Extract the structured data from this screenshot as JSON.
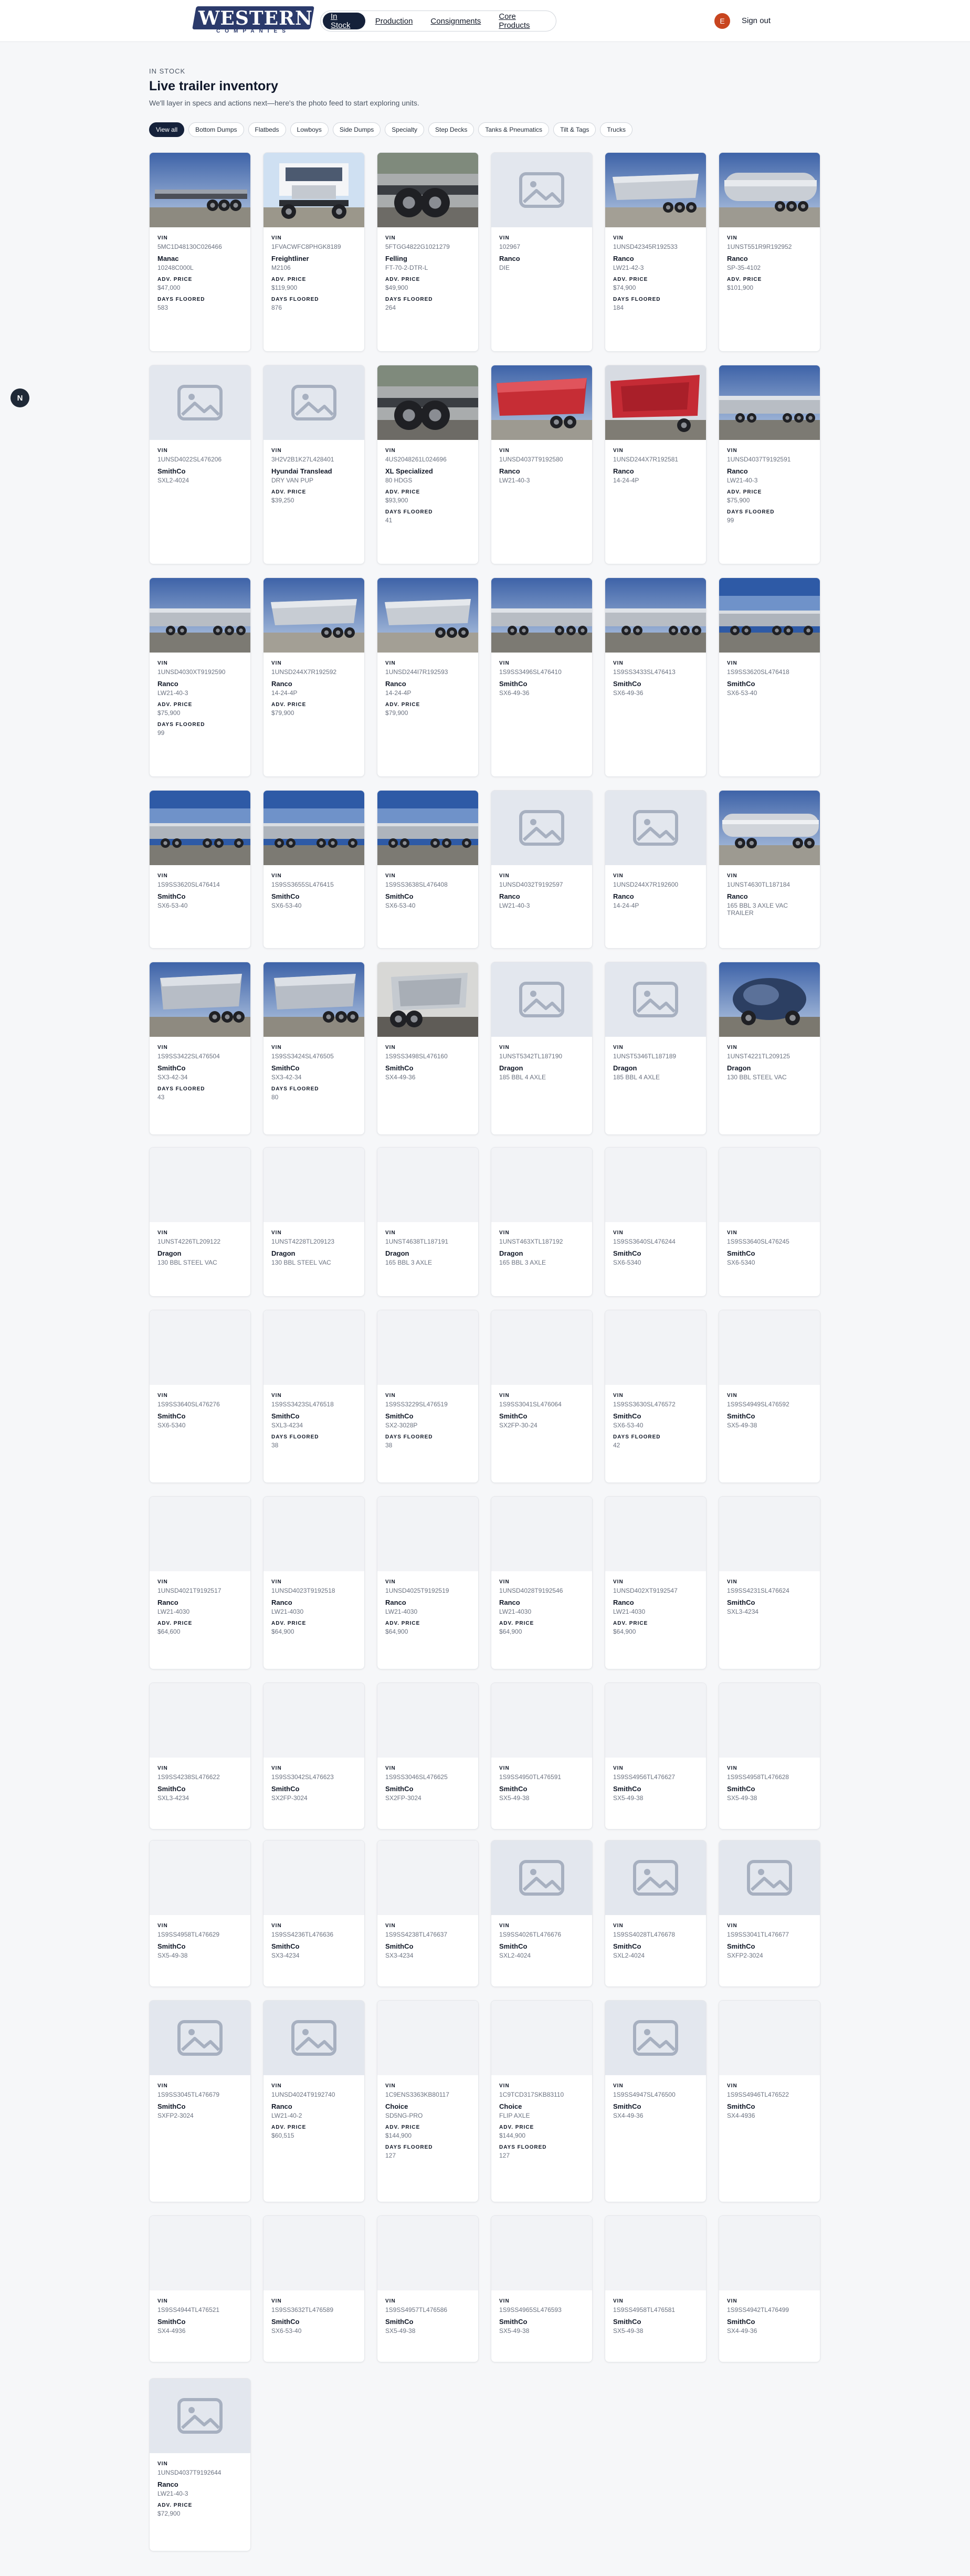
{
  "header": {
    "logo_text": "WESTERN",
    "logo_subtext": "COMPANIES",
    "nav": [
      "In Stock",
      "Production",
      "Consignments",
      "Core Products"
    ],
    "active_nav": "In Stock",
    "avatar_initial": "E",
    "signout_label": "Sign out"
  },
  "sidebar_toggle": "N",
  "page": {
    "eyebrow": "IN STOCK",
    "title": "Live trailer inventory",
    "subtitle": "We'll layer in specs and actions next—here's the photo feed to start exploring units."
  },
  "filters": [
    "View all",
    "Bottom Dumps",
    "Flatbeds",
    "Lowboys",
    "Side Dumps",
    "Specialty",
    "Step Decks",
    "Tanks & Pneumatics",
    "Tilt & Tags",
    "Trucks"
  ],
  "labels": {
    "vin": "VIN",
    "adv_price": "ADV. PRICE",
    "days_floored": "DAYS FLOORED"
  },
  "accent_color": "#15213a",
  "cards": [
    {
      "img": "flatbed",
      "vin": "5MC1D48130C026466",
      "make": "Manac",
      "model": "10248C000L",
      "price": "$47,000",
      "days": "583"
    },
    {
      "img": "truck",
      "vin": "1FVACWFC8PHGK8189",
      "make": "Freightliner",
      "model": "M2106",
      "price": "$119,900",
      "days": "876"
    },
    {
      "img": "lowboy",
      "vin": "5FTGG4822G1021279",
      "make": "Felling",
      "model": "FT-70-2-DTR-L",
      "price": "$49,900",
      "days": "264"
    },
    {
      "img": "none",
      "vin": "102967",
      "make": "Ranco",
      "model": "DIE"
    },
    {
      "img": "sidedump",
      "vin": "1UNSD42345R192533",
      "make": "Ranco",
      "model": "LW21-42-3",
      "price": "$74,900",
      "days": "184"
    },
    {
      "img": "tank",
      "vin": "1UNST551R9R192952",
      "make": "Ranco",
      "model": "SP-35-4102",
      "price": "$101,900"
    },
    {
      "img": "none",
      "vin": "1UNSD4022SL476206",
      "make": "SmithCo",
      "model": "SXL2-4024"
    },
    {
      "img": "none",
      "vin": "3H2V2B1K27L428401",
      "make": "Hyundai Translead",
      "model": "DRY VAN PUP",
      "price": "$39,250"
    },
    {
      "img": "lowboy",
      "vin": "4US2048261L024696",
      "make": "XL Specialized",
      "model": "80 HDGS",
      "price": "$93,900",
      "days": "41"
    },
    {
      "img": "reddump",
      "vin": "1UNSD4037T9192580",
      "make": "Ranco",
      "model": "LW21-40-3"
    },
    {
      "img": "reddump2",
      "vin": "1UNSD244X7R192581",
      "make": "Ranco",
      "model": "14-24-4P"
    },
    {
      "img": "lot",
      "vin": "1UNSD4037T9192591",
      "make": "Ranco",
      "model": "LW21-40-3",
      "price": "$75,900",
      "days": "99"
    },
    {
      "img": "lot",
      "vin": "1UNSD4030XT9192590",
      "make": "Ranco",
      "model": "LW21-40-3",
      "price": "$75,900",
      "days": "99"
    },
    {
      "img": "sidedump",
      "vin": "1UNSD244X7R192592",
      "make": "Ranco",
      "model": "14-24-4P",
      "price": "$79,900"
    },
    {
      "img": "sidedump",
      "vin": "1UNSD244I7R192593",
      "make": "Ranco",
      "model": "14-24-4P",
      "price": "$79,900"
    },
    {
      "img": "lot",
      "vin": "1S9SS3496SL476410",
      "make": "SmithCo",
      "model": "SX6-49-36"
    },
    {
      "img": "lot",
      "vin": "1S9SS3433SL476413",
      "make": "SmithCo",
      "model": "SX6-49-36"
    },
    {
      "img": "lot2",
      "vin": "1S9SS3620SL476418",
      "make": "SmithCo",
      "model": "SX6-53-40"
    },
    {
      "img": "lot2",
      "vin": "1S9SS3620SL476414",
      "make": "SmithCo",
      "model": "SX6-53-40"
    },
    {
      "img": "lot2",
      "vin": "1S9SS3655SL476415",
      "make": "SmithCo",
      "model": "SX6-53-40"
    },
    {
      "img": "lot2",
      "vin": "1S9SS3638SL476408",
      "make": "SmithCo",
      "model": "SX6-53-40"
    },
    {
      "img": "none",
      "vin": "1UNSD4032T9192597",
      "make": "Ranco",
      "model": "LW21-40-3"
    },
    {
      "img": "none",
      "vin": "1UNSD244X7R192600",
      "make": "Ranco",
      "model": "14-24-4P"
    },
    {
      "img": "tanktrailer",
      "vin": "1UNST4630TL187184",
      "make": "Ranco",
      "model": "165 BBL 3 AXLE VAC TRAILER"
    },
    {
      "img": "sidedump2",
      "vin": "1S9SS3422SL476504",
      "make": "SmithCo",
      "model": "SX3-42-34",
      "days": "43"
    },
    {
      "img": "sidedump2",
      "vin": "1S9SS3424SL476505",
      "make": "SmithCo",
      "model": "SX3-42-34",
      "days": "80"
    },
    {
      "img": "sidedump3",
      "vin": "1S9SS3498SL476160",
      "make": "SmithCo",
      "model": "SX4-49-36"
    },
    {
      "img": "none",
      "vin": "1UNST5342TL187190",
      "make": "Dragon",
      "model": "185 BBL 4 AXLE"
    },
    {
      "img": "none",
      "vin": "1UNST5346TL187189",
      "make": "Dragon",
      "model": "185 BBL 4 AXLE"
    },
    {
      "img": "vac",
      "vin": "1UNST4221TL209125",
      "make": "Dragon",
      "model": "130 BBL STEEL VAC"
    },
    {
      "img": "blank",
      "vin": "1UNST4226TL209122",
      "make": "Dragon",
      "model": "130 BBL STEEL VAC"
    },
    {
      "img": "blank",
      "vin": "1UNST4228TL209123",
      "make": "Dragon",
      "model": "130 BBL STEEL VAC"
    },
    {
      "img": "blank",
      "vin": "1UNST4638TL187191",
      "make": "Dragon",
      "model": "165 BBL 3 AXLE"
    },
    {
      "img": "blank",
      "vin": "1UNST463XTL187192",
      "make": "Dragon",
      "model": "165 BBL 3 AXLE"
    },
    {
      "img": "blank",
      "vin": "1S9SS3640SL476244",
      "make": "SmithCo",
      "model": "SX6-5340"
    },
    {
      "img": "blank",
      "vin": "1S9SS3640SL476245",
      "make": "SmithCo",
      "model": "SX6-5340"
    },
    {
      "img": "blank",
      "vin": "1S9SS3640SL476276",
      "make": "SmithCo",
      "model": "SX6-5340"
    },
    {
      "img": "blank",
      "vin": "1S9SS3423SL476518",
      "make": "SmithCo",
      "model": "SXL3-4234",
      "days": "38"
    },
    {
      "img": "blank",
      "vin": "1S9SS3229SL476519",
      "make": "SmithCo",
      "model": "SX2-3028P",
      "days": "38"
    },
    {
      "img": "blank",
      "vin": "1S9SS3041SL476064",
      "make": "SmithCo",
      "model": "SX2FP-30-24"
    },
    {
      "img": "blank",
      "vin": "1S9SS3630SL476572",
      "make": "SmithCo",
      "model": "SX6-53-40",
      "days": "42"
    },
    {
      "img": "blank",
      "vin": "1S9SS4949SL476592",
      "make": "SmithCo",
      "model": "SX5-49-38"
    },
    {
      "img": "blank",
      "vin": "1UNSD4021T9192517",
      "make": "Ranco",
      "model": "LW21-4030",
      "price": "$64,600"
    },
    {
      "img": "blank",
      "vin": "1UNSD4023T9192518",
      "make": "Ranco",
      "model": "LW21-4030",
      "price": "$64,900"
    },
    {
      "img": "blank",
      "vin": "1UNSD4025T9192519",
      "make": "Ranco",
      "model": "LW21-4030",
      "price": "$64,900"
    },
    {
      "img": "blank",
      "vin": "1UNSD4028T9192546",
      "make": "Ranco",
      "model": "LW21-4030",
      "price": "$64,900"
    },
    {
      "img": "blank",
      "vin": "1UNSD402XT9192547",
      "make": "Ranco",
      "model": "LW21-4030",
      "price": "$64,900"
    },
    {
      "img": "blank",
      "vin": "1S9SS4231SL476624",
      "make": "SmithCo",
      "model": "SXL3-4234"
    },
    {
      "img": "blank",
      "vin": "1S9SS4238SL476622",
      "make": "SmithCo",
      "model": "SXL3-4234"
    },
    {
      "img": "blank",
      "vin": "1S9SS3042SL476623",
      "make": "SmithCo",
      "model": "SX2FP-3024"
    },
    {
      "img": "blank",
      "vin": "1S9SS3046SL476625",
      "make": "SmithCo",
      "model": "SX2FP-3024"
    },
    {
      "img": "blank",
      "vin": "1S9SS4950TL476591",
      "make": "SmithCo",
      "model": "SX5-49-38"
    },
    {
      "img": "blank",
      "vin": "1S9SS4956TL476627",
      "make": "SmithCo",
      "model": "SX5-49-38"
    },
    {
      "img": "blank",
      "vin": "1S9SS4958TL476628",
      "make": "SmithCo",
      "model": "SX5-49-38"
    },
    {
      "img": "blank",
      "vin": "1S9SS4958TL476629",
      "make": "SmithCo",
      "model": "SX5-49-38"
    },
    {
      "img": "blank",
      "vin": "1S9SS4236TL476636",
      "make": "SmithCo",
      "model": "SX3-4234"
    },
    {
      "img": "blank",
      "vin": "1S9SS4238TL476637",
      "make": "SmithCo",
      "model": "SX3-4234"
    },
    {
      "img": "none",
      "vin": "1S9SS4026TL476676",
      "make": "SmithCo",
      "model": "SXL2-4024"
    },
    {
      "img": "none",
      "vin": "1S9SS4028TL476678",
      "make": "SmithCo",
      "model": "SXL2-4024"
    },
    {
      "img": "none",
      "vin": "1S9SS3041TL476677",
      "make": "SmithCo",
      "model": "SXFP2-3024"
    },
    {
      "img": "none",
      "vin": "1S9SS3045TL476679",
      "make": "SmithCo",
      "model": "SXFP2-3024"
    },
    {
      "img": "none",
      "vin": "1UNSD4024T9192740",
      "make": "Ranco",
      "model": "LW21-40-2",
      "price": "$60,515"
    },
    {
      "img": "blank",
      "vin": "1C9ENS3363KB80117",
      "make": "Choice",
      "model": "SD5NG-PRO",
      "price": "$144,900",
      "days": "127"
    },
    {
      "img": "blank",
      "vin": "1C9TCD317SKB83110",
      "make": "Choice",
      "model": "FLIP AXLE",
      "price": "$144,900",
      "days": "127"
    },
    {
      "img": "none",
      "vin": "1S9SS4947SL476500",
      "make": "SmithCo",
      "model": "SX4-49-36"
    },
    {
      "img": "blank",
      "vin": "1S9SS4946TL476522",
      "make": "SmithCo",
      "model": "SX4-4936"
    },
    {
      "img": "blank",
      "vin": "1S9SS4944TL476521",
      "make": "SmithCo",
      "model": "SX4-4936"
    },
    {
      "img": "blank",
      "vin": "1S9SS3632TL476589",
      "make": "SmithCo",
      "model": "SX6-53-40"
    },
    {
      "img": "blank",
      "vin": "1S9SS4957TL476586",
      "make": "SmithCo",
      "model": "SX5-49-38"
    },
    {
      "img": "blank",
      "vin": "1S9SS4965SL476593",
      "make": "SmithCo",
      "model": "SX5-49-38"
    },
    {
      "img": "blank",
      "vin": "1S9SS4958TL476581",
      "make": "SmithCo",
      "model": "SX5-49-38"
    },
    {
      "img": "blank",
      "vin": "1S9SS4942TL476499",
      "make": "SmithCo",
      "model": "SX4-49-36"
    },
    {
      "img": "none",
      "vin": "1UNSD4037T9192644",
      "make": "Ranco",
      "model": "LW21-40-3",
      "price": "$72,900"
    }
  ]
}
